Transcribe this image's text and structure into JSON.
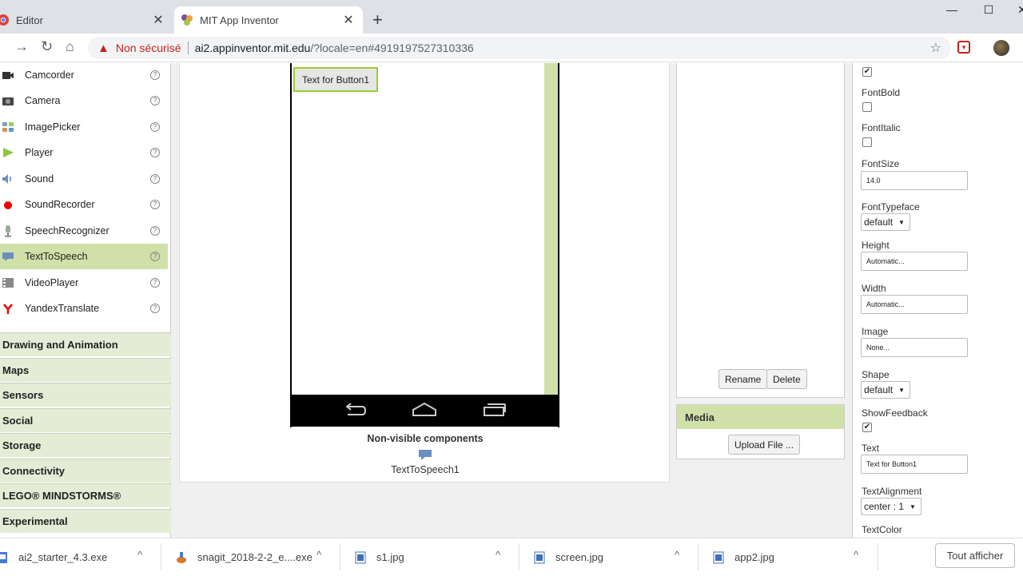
{
  "browser": {
    "tabs": [
      {
        "title": "Editor",
        "close": "✕"
      },
      {
        "title": "MIT App Inventor",
        "close": "✕"
      }
    ],
    "new_tab": "+",
    "window_controls": {
      "minimize": "—",
      "maximize": "☐",
      "close": "✕"
    },
    "security_label": "Non sécurisé",
    "url_host": "ai2.appinventor.mit.edu",
    "url_rest": "/?locale=en#4919197527310336"
  },
  "palette": {
    "items": [
      {
        "label": "Camcorder",
        "icon": "camcorder-icon"
      },
      {
        "label": "Camera",
        "icon": "camera-icon"
      },
      {
        "label": "ImagePicker",
        "icon": "image-picker-icon"
      },
      {
        "label": "Player",
        "icon": "player-icon"
      },
      {
        "label": "Sound",
        "icon": "sound-icon"
      },
      {
        "label": "SoundRecorder",
        "icon": "sound-recorder-icon"
      },
      {
        "label": "SpeechRecognizer",
        "icon": "speech-recognizer-icon"
      },
      {
        "label": "TextToSpeech",
        "icon": "text-to-speech-icon"
      },
      {
        "label": "VideoPlayer",
        "icon": "video-player-icon"
      },
      {
        "label": "YandexTranslate",
        "icon": "yandex-translate-icon"
      }
    ],
    "help_glyph": "?",
    "categories": [
      "Drawing and Animation",
      "Maps",
      "Sensors",
      "Social",
      "Storage",
      "Connectivity",
      "LEGO® MINDSTORMS®",
      "Experimental"
    ]
  },
  "viewer": {
    "button_text": "Text for Button1",
    "nonvisible_label": "Non-visible components",
    "nonvisible_item": "TextToSpeech1"
  },
  "components": {
    "rename": "Rename",
    "delete": "Delete"
  },
  "media": {
    "title": "Media",
    "upload": "Upload File ..."
  },
  "properties": {
    "fontbold_label": "FontBold",
    "fontitalic_label": "FontItalic",
    "fontsize_label": "FontSize",
    "fontsize_value": "14.0",
    "fonttypeface_label": "FontTypeface",
    "fonttypeface_value": "default",
    "height_label": "Height",
    "height_value": "Automatic...",
    "width_label": "Width",
    "width_value": "Automatic...",
    "image_label": "Image",
    "image_value": "None...",
    "shape_label": "Shape",
    "shape_value": "default",
    "showfeedback_label": "ShowFeedback",
    "text_label": "Text",
    "text_value": "Text for Button1",
    "textalignment_label": "TextAlignment",
    "textalignment_value": "center : 1",
    "textcolor_label": "TextColor",
    "checkmark": "✔"
  },
  "downloads": {
    "items": [
      "ai2_starter_4.3.exe",
      "snagit_2018-2-2_e....exe",
      "s1.jpg",
      "screen.jpg",
      "app2.jpg"
    ],
    "caret": "^",
    "show_all": "Tout afficher"
  }
}
